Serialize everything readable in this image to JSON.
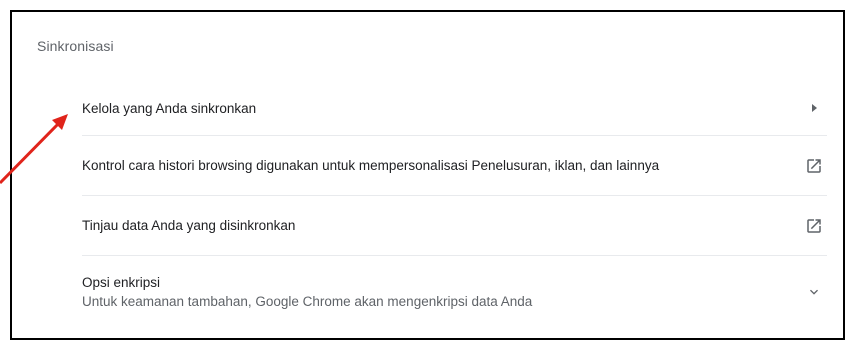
{
  "section": {
    "title": "Sinkronisasi"
  },
  "rows": [
    {
      "label": "Kelola yang Anda sinkronkan",
      "icon": "triangle-right-icon"
    },
    {
      "label": "Kontrol cara histori browsing digunakan untuk mempersonalisasi Penelusuran, iklan, dan lainnya",
      "icon": "open-in-new-icon"
    },
    {
      "label": "Tinjau data Anda yang disinkronkan",
      "icon": "open-in-new-icon"
    },
    {
      "label": "Opsi enkripsi",
      "sublabel": "Untuk keamanan tambahan, Google Chrome akan mengenkripsi data Anda",
      "icon": "chevron-down-icon"
    }
  ],
  "colors": {
    "annotation_arrow": "#e0241b",
    "icon": "#5f6368",
    "divider": "#e8eaed"
  }
}
